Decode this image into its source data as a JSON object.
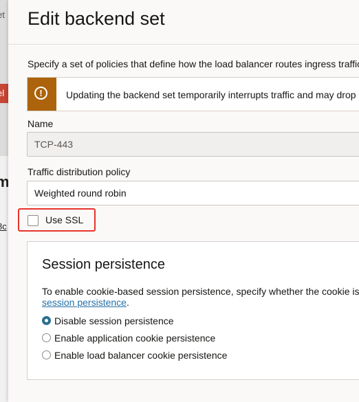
{
  "background": {
    "fragment_top": "et",
    "fragment_button": "el",
    "fragment_heading": "m",
    "fragment_link": "8c"
  },
  "panel": {
    "title": "Edit backend set",
    "intro": "Specify a set of policies that define how the load balancer routes ingress traffic",
    "warning": "Updating the backend set temporarily interrupts traffic and may drop a",
    "warning_icon": "exclamation-icon",
    "warning_color": "#ac630c"
  },
  "form": {
    "name_label": "Name",
    "name_value": "TCP-443",
    "policy_label": "Traffic distribution policy",
    "policy_value": "Weighted round robin",
    "ssl_label": "Use SSL",
    "ssl_checked": false
  },
  "session": {
    "title": "Session persistence",
    "description": "To enable cookie-based session persistence, specify whether the cookie is",
    "link_text": "session persistence",
    "link_suffix": ".",
    "options": [
      {
        "label": "Disable session persistence",
        "selected": true
      },
      {
        "label": "Enable application cookie persistence",
        "selected": false
      },
      {
        "label": "Enable load balancer cookie persistence",
        "selected": false
      }
    ]
  },
  "colors": {
    "link": "#2570a8",
    "highlight": "#e8322b",
    "radio_selected": "#2b6f8f"
  }
}
